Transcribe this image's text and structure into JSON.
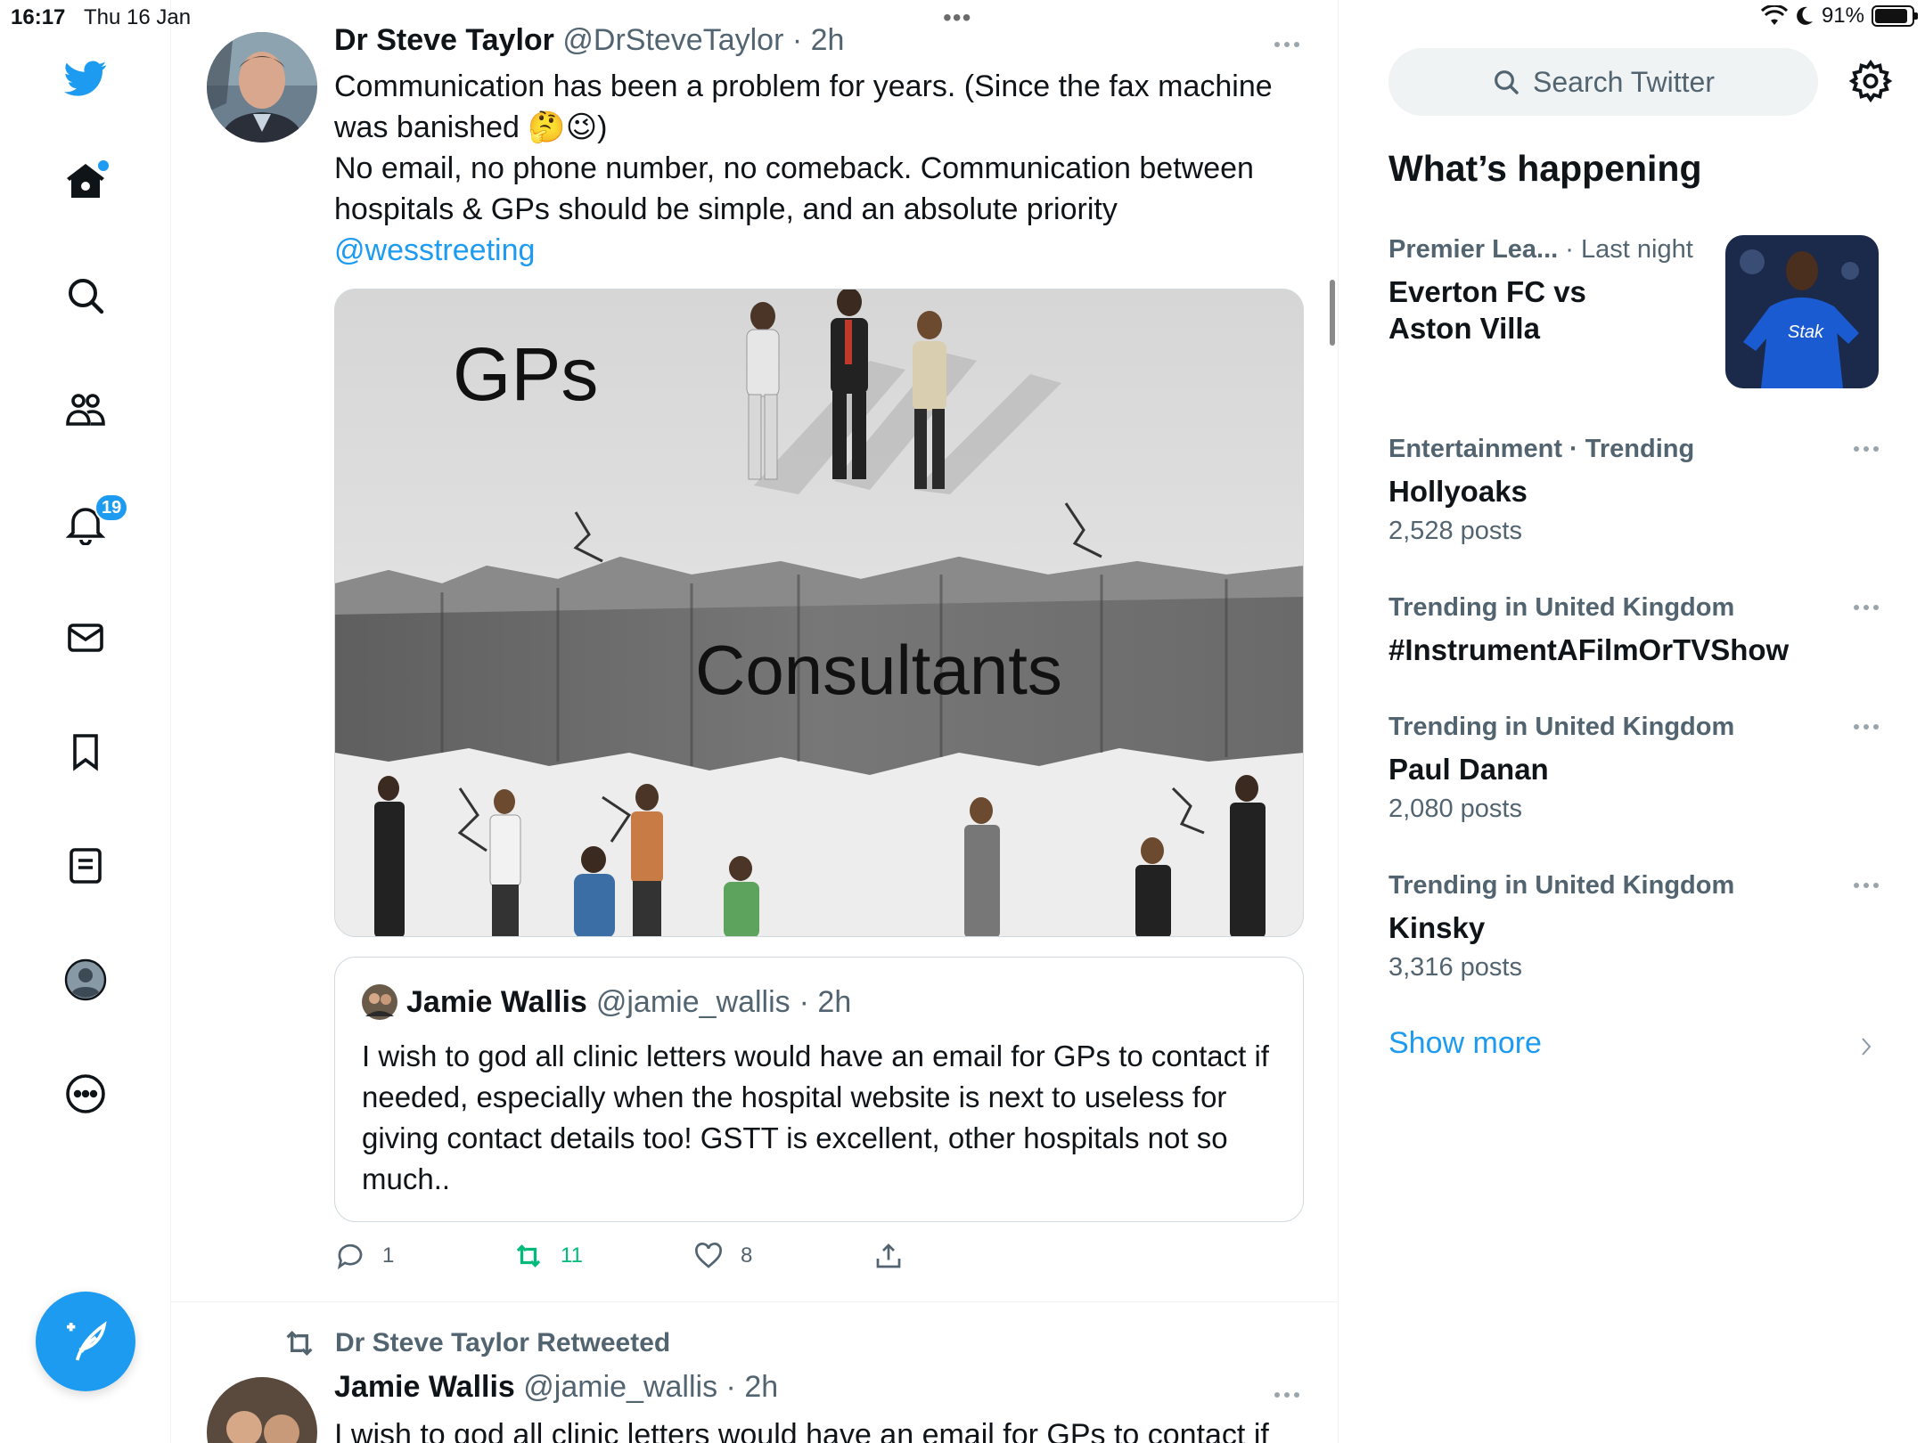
{
  "status_bar": {
    "time": "16:17",
    "date": "Thu 16 Jan",
    "battery": "91%",
    "battery_level": 0.91
  },
  "nav": {
    "notifications_badge": "19"
  },
  "tweet": {
    "author_name": "Dr Steve Taylor",
    "author_handle": "@DrSteveTaylor",
    "time": "· 2h",
    "text_line1": "Communication has been a problem for years. (Since the fax machine was banished 🤔😉)",
    "text_line2": "No email, no phone number, no comeback. Communication between hospitals & GPs should be simple, and an absolute priority",
    "mention": "@wesstreeting",
    "media": {
      "top_label": "GPs",
      "bottom_label": "Consultants"
    },
    "quote": {
      "name": "Jamie Wallis",
      "handle": "@jamie_wallis",
      "time": "· 2h",
      "text": "I wish to god all clinic letters would have an email for GPs to contact if needed, especially when the hospital website is next to useless for giving contact details too! GSTT is excellent, other hospitals not so much.."
    },
    "actions": {
      "replies": "1",
      "retweets": "11",
      "likes": "8"
    }
  },
  "next_tweet": {
    "retweeted_by": "Dr Steve Taylor Retweeted",
    "author_name": "Jamie Wallis",
    "author_handle": "@jamie_wallis",
    "time": "· 2h",
    "text": "I wish to god all clinic letters would have an email for GPs to contact if"
  },
  "sidebar": {
    "search_placeholder": "Search Twitter",
    "section_title": "What’s happening",
    "trends": [
      {
        "meta": "Premier Lea...",
        "meta_time": "· Last night",
        "title_line1": "Everton FC vs",
        "title_line2": "Aston Villa"
      },
      {
        "meta": "Entertainment · Trending",
        "title": "Hollyoaks",
        "count": "2,528 posts"
      },
      {
        "meta": "Trending in United Kingdom",
        "title": "#InstrumentAFilmOrTVShow"
      },
      {
        "meta": "Trending in United Kingdom",
        "title": "Paul Danan",
        "count": "2,080 posts"
      },
      {
        "meta": "Trending in United Kingdom",
        "title": "Kinsky",
        "count": "3,316 posts"
      }
    ],
    "show_more": "Show more"
  },
  "colors": {
    "accent": "#1d9bf0",
    "retweet_green": "#00ba7c",
    "secondary_text": "#536471"
  }
}
